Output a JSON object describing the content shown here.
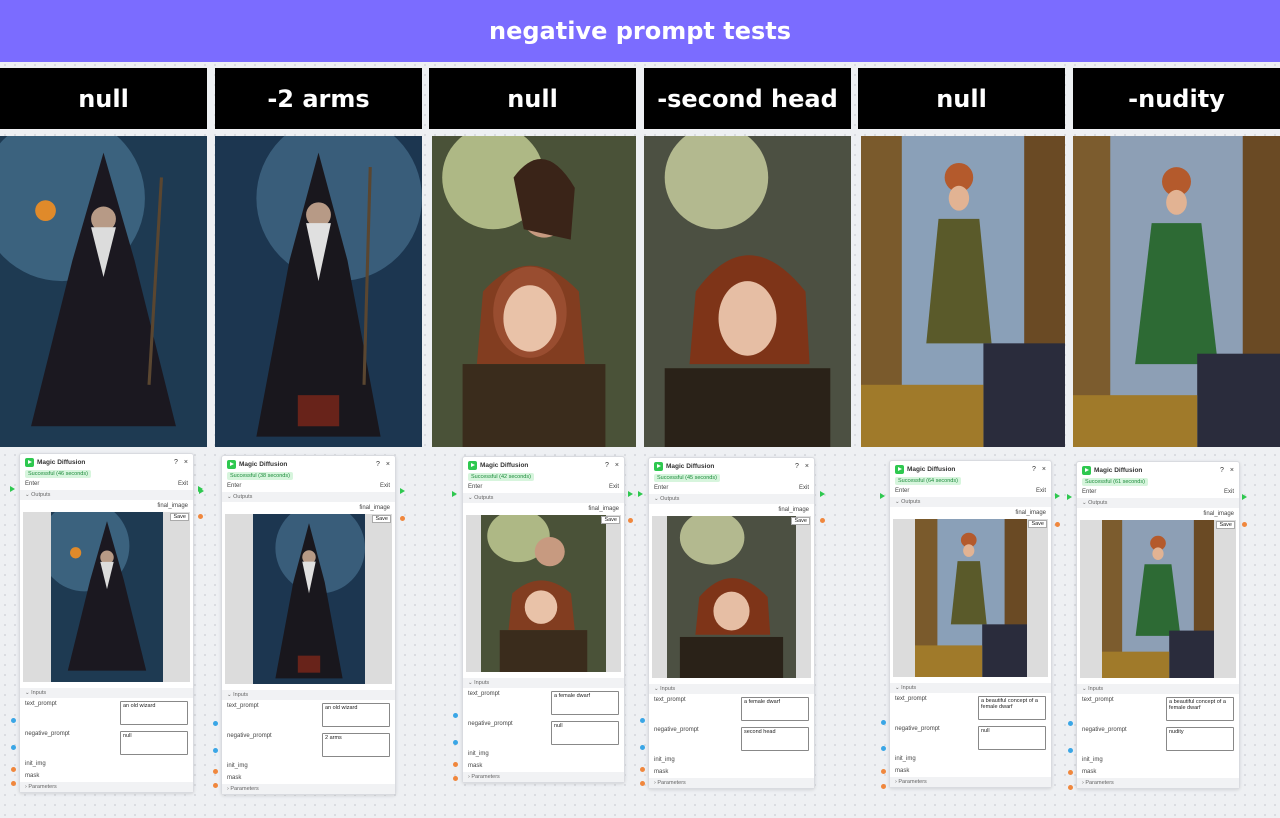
{
  "title": "negative prompt tests",
  "headers": [
    "null",
    "-2 arms",
    "null",
    "-second head",
    "null",
    "-nudity"
  ],
  "node": {
    "title": "Magic Diffusion",
    "help": "?",
    "close": "×",
    "enter": "Enter",
    "exit": "Exit",
    "outputs": "Outputs",
    "final_image": "final_image",
    "save": "Save",
    "inputs": "Inputs",
    "text_prompt": "text_prompt",
    "negative_prompt": "negative_prompt",
    "init_img": "init_img",
    "mask": "mask",
    "parameters": "Parameters"
  },
  "panels": [
    {
      "status": "Successful (46 seconds)",
      "prompt": "an old wizard",
      "negative": "null"
    },
    {
      "status": "Successful (38 seconds)",
      "prompt": "an old wizard",
      "negative": "2 arms"
    },
    {
      "status": "Successful (42 seconds)",
      "prompt": "a female dwarf",
      "negative": "null"
    },
    {
      "status": "Successful (45 seconds)",
      "prompt": "a female dwarf",
      "negative": "second head"
    },
    {
      "status": "Successful (64 seconds)",
      "prompt": "a beautiful concept of a female dwarf",
      "negative": "null"
    },
    {
      "status": "Successful (61 seconds)",
      "prompt": "a beautiful concept of a female dwarf",
      "negative": "nudity"
    }
  ],
  "icons": {
    "play": "play-icon",
    "chevron": "chevron-down-icon",
    "expand": "chevron-right-icon"
  },
  "colors": {
    "banner": "#7b6cff",
    "header_bg": "#000000",
    "status_green": "#2ec84f"
  }
}
